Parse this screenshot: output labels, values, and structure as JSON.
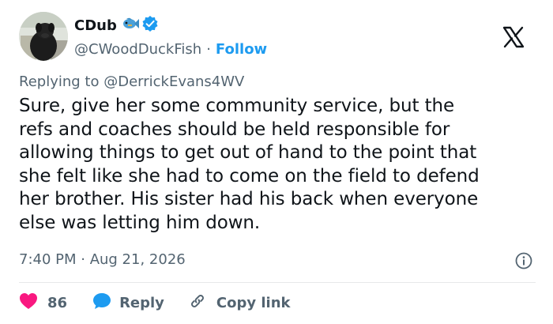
{
  "author": {
    "display_name": "CDub",
    "handle": "@CWoodDuckFish",
    "separator": "·",
    "follow_label": "Follow"
  },
  "reply": {
    "prefix": "Replying to",
    "mention": "@DerrickEvans4WV"
  },
  "tweet": {
    "lines": [
      "Sure, give her some community service, but the",
      "refs and coaches should be held responsible for",
      "allowing things to get out of hand to the point that",
      "she felt like she had to come on the field to defend",
      "her brother. His sister had his back when everyone",
      "else was letting him down."
    ],
    "timestamp": "7:40 PM · Aug 21, 2026"
  },
  "actions": {
    "like_count": "86",
    "reply_label": "Reply",
    "copy_link_label": "Copy link"
  },
  "colors": {
    "text": "#0f1419",
    "secondary": "#536471",
    "accent": "#1d9bf0",
    "like": "#f91880",
    "divider": "#e7e9ea"
  },
  "icons": {
    "verified": "verified-badge-icon",
    "fish": "fish-emoji-icon",
    "x_logo": "x-logo-icon",
    "info": "info-icon",
    "like": "heart-icon",
    "reply": "speech-bubble-icon",
    "copy": "link-icon"
  }
}
